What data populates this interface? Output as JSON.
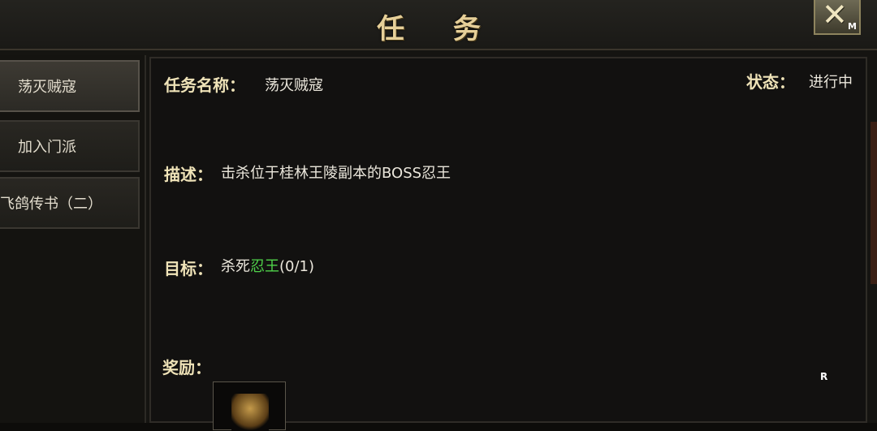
{
  "window": {
    "title": "任 务",
    "close_icon": "close-x-icon",
    "close_hotkey": "M"
  },
  "sidebar": {
    "items": [
      {
        "label": "荡灭贼寇",
        "active": true
      },
      {
        "label": "加入门派",
        "active": false
      },
      {
        "label": "飞鸽传书（二）",
        "active": false
      }
    ]
  },
  "quest": {
    "name_label": "任务名称：",
    "name_value": "荡灭贼寇",
    "status_label": "状态：",
    "status_value": "进行中",
    "desc_label": "描述：",
    "desc_value": "击杀位于桂林王陵副本的BOSS忍王",
    "goal_label": "目标：",
    "goal_prefix": "杀死",
    "goal_target": "忍王",
    "goal_progress": "(0/1)",
    "reward_label": "奖励：",
    "reward_item_icon": "reward-item-icon",
    "hotkey": "R"
  },
  "colors": {
    "label": "#efe3b8",
    "target_green": "#4fd24a",
    "title_gold": "#e6cf98"
  }
}
